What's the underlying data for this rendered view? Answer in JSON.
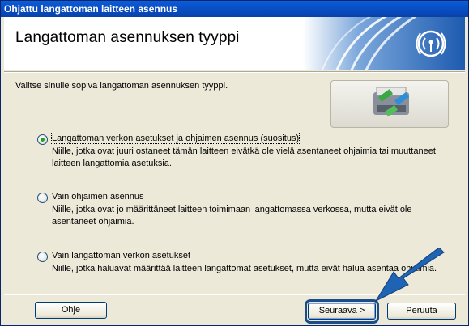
{
  "window": {
    "title": "Ohjattu langattoman laitteen asennus"
  },
  "header": {
    "title": "Langattoman asennuksen tyyppi",
    "logo_icon": "wireless-signal-icon"
  },
  "main": {
    "instruction": "Valitse sinulle sopiva langattoman asennuksen tyyppi.",
    "illustration_icon": "wireless-printer-icon",
    "options": [
      {
        "label": "Langattoman verkon asetukset ja ohjaimen asennus (suositus)",
        "description": "Niille, jotka ovat juuri ostaneet tämän laitteen eivätkä ole vielä asentaneet ohjaimia tai muuttaneet laitteen langattomia asetuksia.",
        "selected": true
      },
      {
        "label": "Vain ohjaimen asennus",
        "description": "Niille, jotka ovat jo määrittäneet laitteen toimimaan langattomassa verkossa, mutta eivät ole asentaneet ohjaimia.",
        "selected": false
      },
      {
        "label": "Vain langattoman verkon asetukset",
        "description": "Niille, jotka haluavat määrittää laitteen langattomat asetukset, mutta eivät halua asentaa ohjaimia.",
        "selected": false
      }
    ]
  },
  "footer": {
    "help_label": "Ohje",
    "next_label": "Seuraava >",
    "cancel_label": "Peruuta"
  },
  "colors": {
    "titlebar": "#0a5fd8",
    "dialog_bg": "#ece9d8",
    "highlight": "#1a4e8a",
    "arrow": "#1f63b4"
  }
}
